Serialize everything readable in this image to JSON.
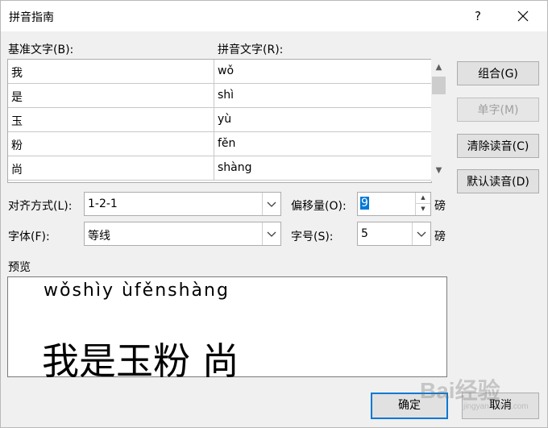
{
  "window": {
    "title": "拼音指南",
    "help_label": "?",
    "close_icon": "close-icon"
  },
  "labels": {
    "base_text": "基准文字(B):",
    "pinyin_text": "拼音文字(R):",
    "align": "对齐方式(L):",
    "offset": "偏移量(O):",
    "font": "字体(F):",
    "size": "字号(S):",
    "unit1": "磅",
    "unit2": "磅",
    "preview": "预览"
  },
  "rows": [
    {
      "base": "我",
      "pinyin": "wǒ"
    },
    {
      "base": "是",
      "pinyin": "shì"
    },
    {
      "base": "玉",
      "pinyin": "yù"
    },
    {
      "base": "粉",
      "pinyin": "fěn"
    },
    {
      "base": "尚",
      "pinyin": "shàng"
    }
  ],
  "buttons": {
    "group": "组合(G)",
    "single": "单字(M)",
    "clear": "清除读音(C)",
    "default": "默认读音(D)",
    "ok": "确定",
    "cancel": "取消"
  },
  "fields": {
    "align_value": "1-2-1",
    "offset_value": "9",
    "font_value": "等线",
    "size_value": "5"
  },
  "preview": {
    "pinyin": "wǒshìy ùfěnshàng",
    "hanzi": "我是玉粉 尚"
  },
  "watermark": {
    "brand": "Bai经验",
    "sub": "jingyan.baidu.com"
  },
  "colors": {
    "accent": "#0078d7",
    "disabled_text": "#a0a0a0"
  }
}
